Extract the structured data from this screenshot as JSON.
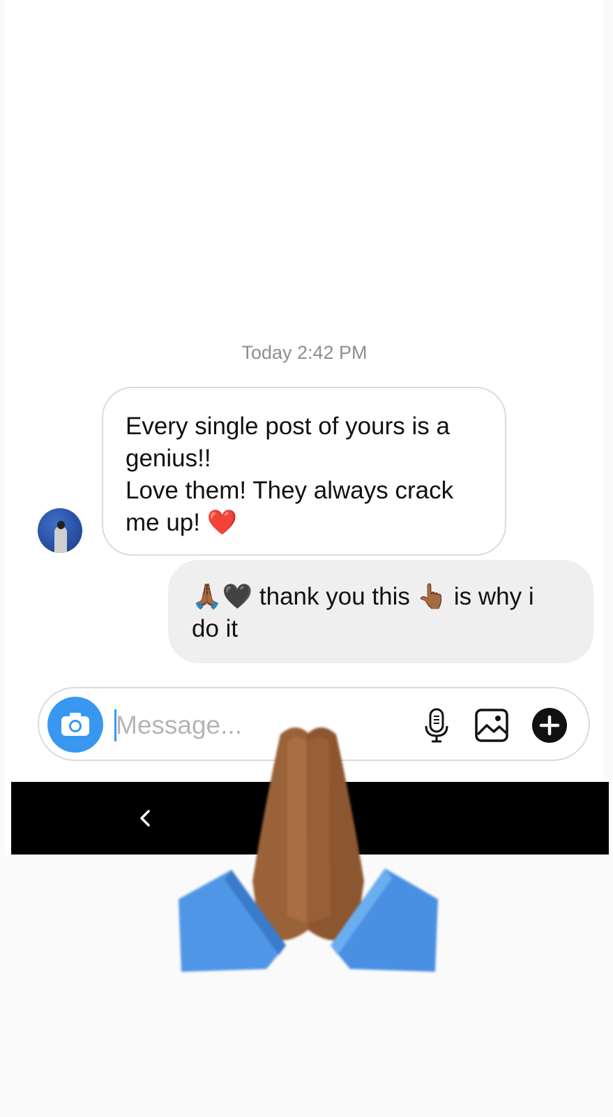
{
  "thread": {
    "timestamp": "Today 2:42 PM"
  },
  "messages": {
    "received": {
      "lines": [
        "Every single post of yours is a",
        "genius!!",
        "Love them! They always crack",
        "me up! ❤️"
      ]
    },
    "sent": {
      "lines": [
        "🙏🏾🖤 thank you this 👆🏾 is why i",
        "do it"
      ]
    }
  },
  "composer": {
    "placeholder": "Message...",
    "value": ""
  },
  "icons": {
    "camera": "camera-icon",
    "microphone": "microphone-icon",
    "gallery": "gallery-icon",
    "add": "plus-circle-icon",
    "back": "chevron-left-icon",
    "overlay": "folded-hands-emoji"
  },
  "colors": {
    "accent": "#3897f0",
    "received_bubble_border": "#dbdbdb",
    "sent_bubble": "#efefef",
    "navbar": "#000000",
    "timestamp": "#8e8e8e"
  }
}
